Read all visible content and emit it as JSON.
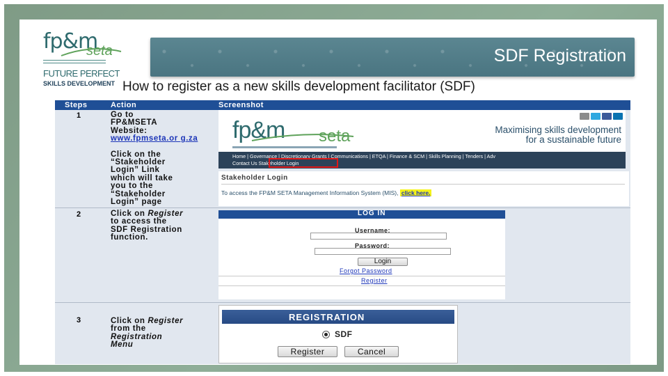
{
  "slide": {
    "title": "SDF Registration",
    "subtitle": "How to register as a new skills development facilitator (SDF)"
  },
  "logo": {
    "name": "fp&m",
    "seta": "seta",
    "tagline_1": "FUTURE PERFECT",
    "tagline_2": "SKILLS DEVELOPMENT"
  },
  "table": {
    "headers": [
      "Steps",
      "Action",
      "Screenshot"
    ],
    "steps": [
      {
        "number": "1",
        "action_lines": [
          "Go to",
          "FP&MSETA",
          "Website:"
        ],
        "action_link": "www.fpmseta.or g.za",
        "action_lines_2": [
          "Click on the",
          "“Stakeholder",
          "Login” Link",
          "which will take",
          "you to the",
          "“Stakeholder",
          "Login” page"
        ]
      },
      {
        "number": "2",
        "action_prefix": "Click on",
        "action_emphasis": "Register",
        "action_suffix_lines": [
          "to access the",
          "SDF Registration",
          "function."
        ]
      },
      {
        "number": "3",
        "action_prefix": "Click on",
        "action_emphasis": "Register",
        "action_suffix": "from the",
        "action_emphasis_2": "Registration",
        "action_emphasis_3": "Menu"
      }
    ]
  },
  "screenshot_website": {
    "logo_text": "fp&m",
    "logo_seta": "seta",
    "slogan_line1": "Maximising skills development",
    "slogan_line2": "for a sustainable future",
    "nav_line1": "Home | Governance | Discretionary Grants | Communications | ETQA | Finance & SCM | Skills Planning | Tenders | Adv",
    "nav_line2": "Contact Us   Stakeholder Login",
    "social_icons": [
      "search-icon",
      "twitter-icon",
      "facebook-icon",
      "linkedin-icon"
    ]
  },
  "screenshot_stakeholder": {
    "heading": "Stakeholder Login",
    "text": "To access the FP&M SETA Management Information System (MIS),",
    "link": "click here."
  },
  "screenshot_login": {
    "header": "LOG IN",
    "username_label": "Username:",
    "password_label": "Password:",
    "login_button": "Login",
    "forgot_link": "Forgot Password",
    "register_link": "Register"
  },
  "screenshot_registration": {
    "header": "REGISTRATION",
    "option": "SDF",
    "register_button": "Register",
    "cancel_button": "Cancel"
  },
  "colors": {
    "frame": "#8fae98",
    "banner": "#527d89",
    "table_header": "#1f4f96",
    "link": "#1c35b8",
    "highlight": "#f5f31a",
    "red_outline": "#e01717"
  }
}
